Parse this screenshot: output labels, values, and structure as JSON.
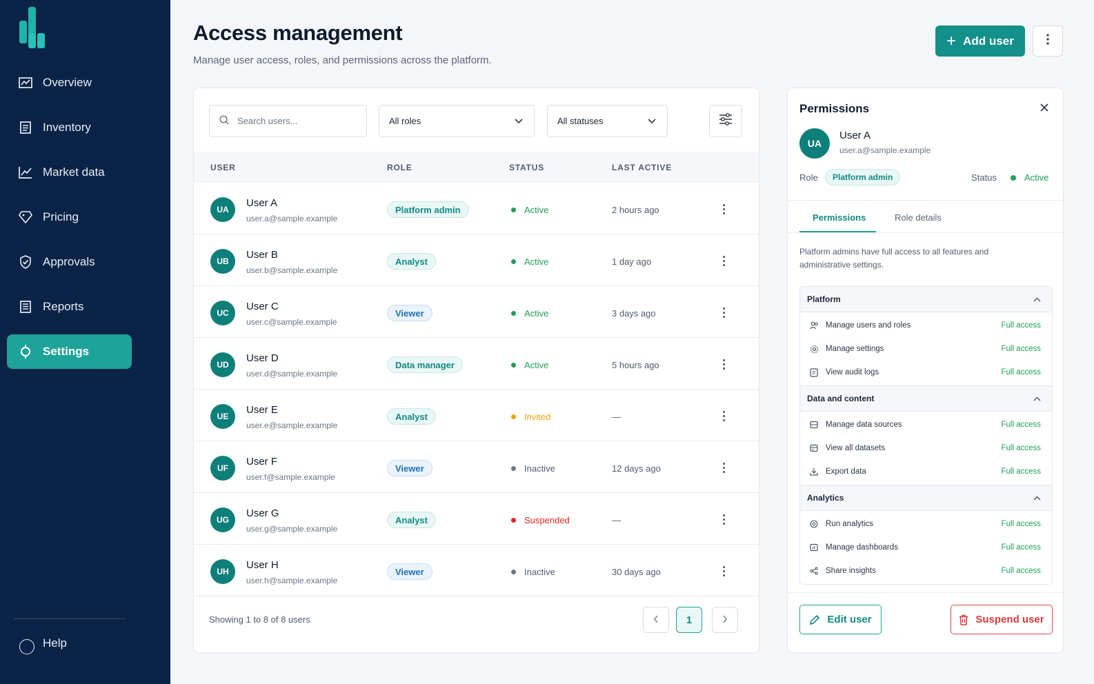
{
  "sidebar": {
    "items": [
      {
        "label": "Overview",
        "icon": "chart-icon"
      },
      {
        "label": "Inventory",
        "icon": "document-icon"
      },
      {
        "label": "Market data",
        "icon": "trend-icon"
      },
      {
        "label": "Pricing",
        "icon": "tag-icon"
      },
      {
        "label": "Approvals",
        "icon": "shield-check-icon"
      },
      {
        "label": "Reports",
        "icon": "report-icon"
      },
      {
        "label": "Settings",
        "icon": "settings-icon",
        "active": true
      }
    ],
    "help_label": "Help"
  },
  "header": {
    "title": "Access management",
    "subtitle": "Manage user access, roles, and permissions across the platform.",
    "add_user_label": "Add user"
  },
  "filters": {
    "search_placeholder": "Search users...",
    "role_select": "All roles",
    "status_select": "All statuses"
  },
  "table": {
    "columns": [
      "USER",
      "ROLE",
      "STATUS",
      "LAST ACTIVE"
    ],
    "rows": [
      {
        "initials": "UA",
        "name": "User A",
        "email": "user.a@sample.example",
        "role": "Platform admin",
        "status": "Active",
        "status_color": "#1f9e58",
        "last_active": "2 hours ago"
      },
      {
        "initials": "UB",
        "name": "User B",
        "email": "user.b@sample.example",
        "role": "Analyst",
        "status": "Active",
        "status_color": "#1f9e58",
        "last_active": "1 day ago"
      },
      {
        "initials": "UC",
        "name": "User C",
        "email": "user.c@sample.example",
        "role": "Viewer",
        "status": "Active",
        "status_color": "#1f9e58",
        "last_active": "3 days ago"
      },
      {
        "initials": "UD",
        "name": "User D",
        "email": "user.d@sample.example",
        "role": "Data manager",
        "status": "Active",
        "status_color": "#1f9e58",
        "last_active": "5 hours ago"
      },
      {
        "initials": "UE",
        "name": "User E",
        "email": "user.e@sample.example",
        "role": "Analyst",
        "status": "Invited",
        "status_color": "#f0a30a",
        "last_active": "—"
      },
      {
        "initials": "UF",
        "name": "User F",
        "email": "user.f@sample.example",
        "role": "Viewer",
        "status": "Inactive",
        "status_color": "#6b7688",
        "last_active": "12 days ago"
      },
      {
        "initials": "UG",
        "name": "User G",
        "email": "user.g@sample.example",
        "role": "Analyst",
        "status": "Suspended",
        "status_color": "#e02424",
        "last_active": "—"
      },
      {
        "initials": "UH",
        "name": "User H",
        "email": "user.h@sample.example",
        "role": "Viewer",
        "status": "Inactive",
        "status_color": "#6b7688",
        "last_active": "30 days ago"
      }
    ],
    "role_colors": {
      "Platform admin": "#128a83",
      "Analyst": "#128a83",
      "Viewer": "#1d72b8",
      "Data manager": "#128a83"
    },
    "showing_text": "Showing 1 to 8 of 8 users",
    "current_page": "1"
  },
  "panel": {
    "title": "Permissions",
    "user": {
      "initials": "UA",
      "name": "User A",
      "email": "user.a@sample.example"
    },
    "role_label": "Role",
    "role": "Platform admin",
    "status_label": "Status",
    "status": "Active",
    "tabs": [
      "Permissions",
      "Role details"
    ],
    "description": "Platform admins have full access to all features and administrative settings.",
    "groups": [
      {
        "name": "Platform",
        "items": [
          {
            "label": "Manage users and roles",
            "icon": "users-icon",
            "access": "Full access"
          },
          {
            "label": "Manage settings",
            "icon": "gear-icon",
            "access": "Full access"
          },
          {
            "label": "View audit logs",
            "icon": "log-icon",
            "access": "Full access"
          }
        ]
      },
      {
        "name": "Data and content",
        "items": [
          {
            "label": "Manage data sources",
            "icon": "database-icon",
            "access": "Full access"
          },
          {
            "label": "View all datasets",
            "icon": "dataset-icon",
            "access": "Full access"
          },
          {
            "label": "Export data",
            "icon": "download-icon",
            "access": "Full access"
          }
        ]
      },
      {
        "name": "Analytics",
        "items": [
          {
            "label": "Run analytics",
            "icon": "analytics-icon",
            "access": "Full access"
          },
          {
            "label": "Manage dashboards",
            "icon": "dashboard-icon",
            "access": "Full access"
          },
          {
            "label": "Share insights",
            "icon": "share-icon",
            "access": "Full access"
          }
        ]
      }
    ],
    "edit_label": "Edit user",
    "suspend_label": "Suspend user"
  }
}
